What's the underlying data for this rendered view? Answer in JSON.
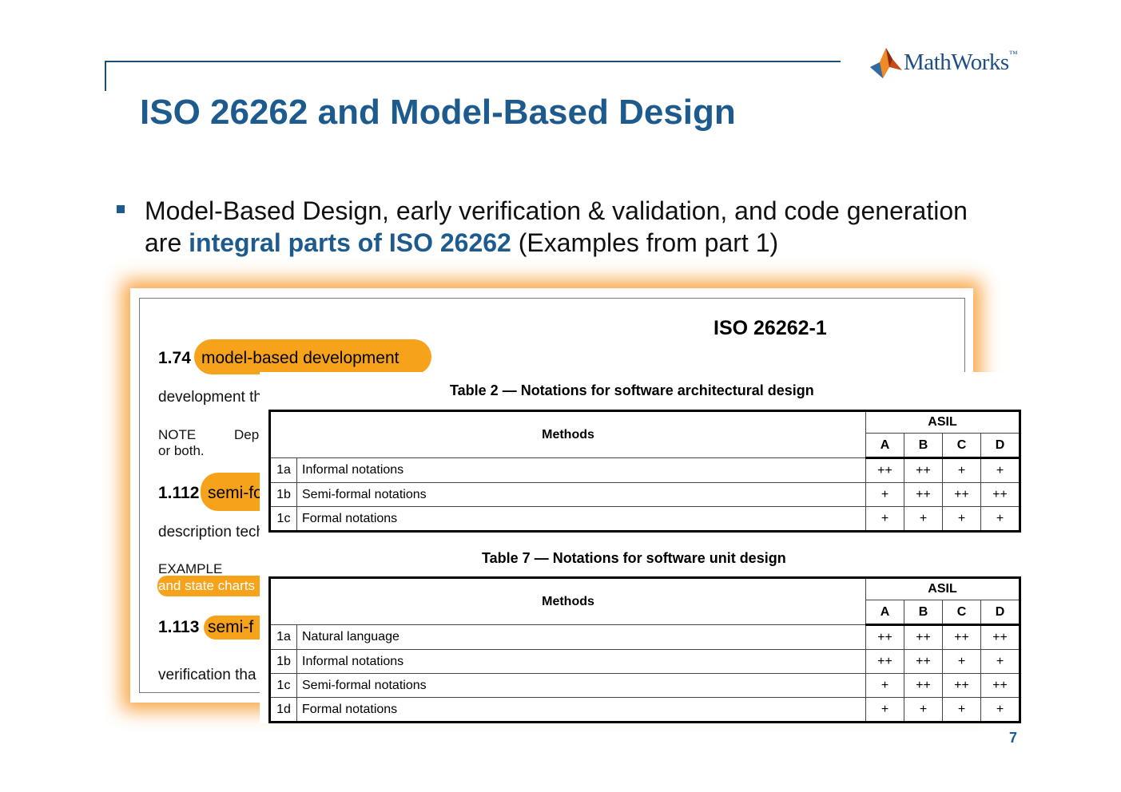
{
  "header": {
    "logo_text": "MathWorks",
    "logo_mark": "™"
  },
  "slide": {
    "title": "ISO 26262 and Model-Based Design",
    "bullet": {
      "line1": "Model-Based Design, early verification & validation, and code generation",
      "prefix": "are ",
      "highlight": "integral parts of ISO 26262",
      "suffix": " (Examples from part 1)"
    },
    "page_number": "7"
  },
  "document": {
    "ref": "ISO 26262-1",
    "terms": [
      {
        "num": "1.74",
        "term": "model-based development",
        "definition": "development th"
      },
      {
        "num": "1.112",
        "term": "semi-fo",
        "definition": "description tech"
      },
      {
        "num": "1.113",
        "term": "semi-f",
        "definition": "verification tha"
      }
    ],
    "note_label": "NOTE",
    "note_text": "Depe",
    "note_line2": "or both.",
    "example_label": "EXAMPLE",
    "example_text": "and state charts"
  },
  "tables": [
    {
      "caption": "Table 2 — Notations for software architectural design",
      "methods_header": "Methods",
      "asil_header": "ASIL",
      "asil_levels": [
        "A",
        "B",
        "C",
        "D"
      ],
      "rows": [
        {
          "id": "1a",
          "method": "Informal notations",
          "values": [
            "++",
            "++",
            "+",
            "+"
          ]
        },
        {
          "id": "1b",
          "method": "Semi-formal notations",
          "values": [
            "+",
            "++",
            "++",
            "++"
          ]
        },
        {
          "id": "1c",
          "method": "Formal notations",
          "values": [
            "+",
            "+",
            "+",
            "+"
          ]
        }
      ]
    },
    {
      "caption": "Table 7 — Notations for software unit design",
      "methods_header": "Methods",
      "asil_header": "ASIL",
      "asil_levels": [
        "A",
        "B",
        "C",
        "D"
      ],
      "rows": [
        {
          "id": "1a",
          "method": "Natural language",
          "values": [
            "++",
            "++",
            "++",
            "++"
          ]
        },
        {
          "id": "1b",
          "method": "Informal notations",
          "values": [
            "++",
            "++",
            "+",
            "+"
          ]
        },
        {
          "id": "1c",
          "method": "Semi-formal notations",
          "values": [
            "+",
            "++",
            "++",
            "++"
          ]
        },
        {
          "id": "1d",
          "method": "Formal notations",
          "values": [
            "+",
            "+",
            "+",
            "+"
          ]
        }
      ]
    }
  ]
}
